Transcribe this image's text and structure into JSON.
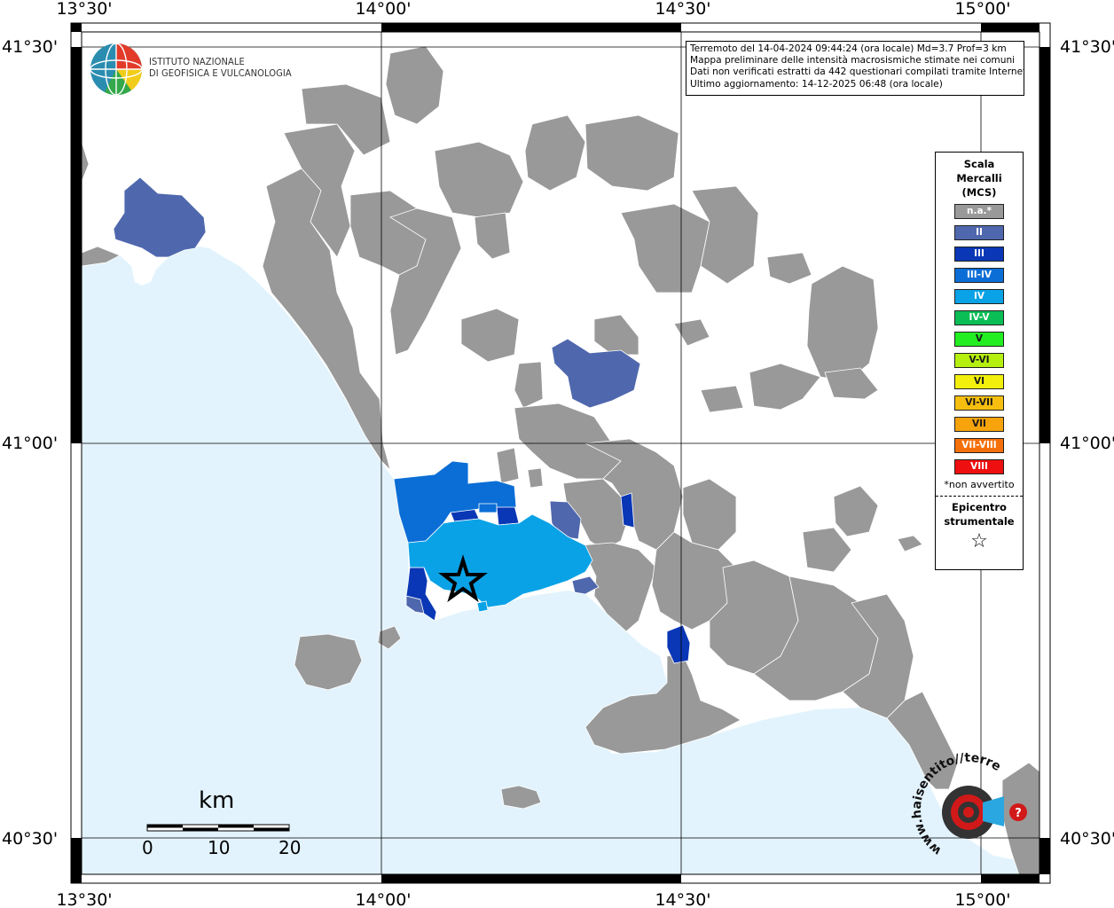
{
  "info": {
    "line1": "Terremoto del 14-04-2024 09:44:24 (ora locale) Md=3.7 Prof=3 km",
    "line2": "Mappa preliminare delle intensità macrosismiche stimate nei comuni",
    "line3": "Dati non verificati estratti da 442 questionari compilati tramite Internet.",
    "line4": "Ultimo aggiornamento: 14-12-2025 06:48 (ora locale)"
  },
  "logo": {
    "line1": "ISTITUTO NAZIONALE",
    "line2": "DI GEOFISICA E VULCANOLOGIA"
  },
  "axes": {
    "lon_top": [
      "13°30'",
      "14°00'",
      "14°30'",
      "15°00'"
    ],
    "lon_bottom": [
      "13°30'",
      "14°00'",
      "14°30'",
      "15°00'"
    ],
    "lat_left": [
      "41°30'",
      "41°00'",
      "40°30'"
    ],
    "lat_right": [
      "41°30'",
      "41°00'",
      "40°30'"
    ]
  },
  "legend": {
    "title1": "Scala",
    "title2": "Mercalli",
    "title3": "(MCS)",
    "items": [
      {
        "label": "n.a.*",
        "color": "#999999"
      },
      {
        "label": "II",
        "color": "#4f67ad"
      },
      {
        "label": "III",
        "color": "#0a37b5"
      },
      {
        "label": "III-IV",
        "color": "#0b6ed6"
      },
      {
        "label": "IV",
        "color": "#0aa2e6"
      },
      {
        "label": "IV-V",
        "color": "#0bbd55"
      },
      {
        "label": "V",
        "color": "#22ee22"
      },
      {
        "label": "V-VI",
        "color": "#b5ef0f"
      },
      {
        "label": "VI",
        "color": "#f2ef0d"
      },
      {
        "label": "VI-VII",
        "color": "#f6bf10"
      },
      {
        "label": "VII",
        "color": "#f7a30c"
      },
      {
        "label": "VII-VIII",
        "color": "#f5700a"
      },
      {
        "label": "VIII",
        "color": "#ee1010"
      }
    ],
    "na_note": "*non avvertito",
    "epi1": "Epicentro",
    "epi2": "strumentale",
    "star": "☆"
  },
  "scalebar": {
    "title": "km",
    "labels": [
      "0",
      "10",
      "20"
    ]
  },
  "watermark": {
    "text": "www.haisentito//terremoto.it",
    "q": "?"
  },
  "colors": {
    "sea": "#e2f3fd",
    "land_na": "#999999",
    "intensity_II": "#4f67ad",
    "intensity_III": "#0a37b5",
    "intensity_III_IV": "#0b6ed6",
    "intensity_IV": "#0aa2e6"
  }
}
